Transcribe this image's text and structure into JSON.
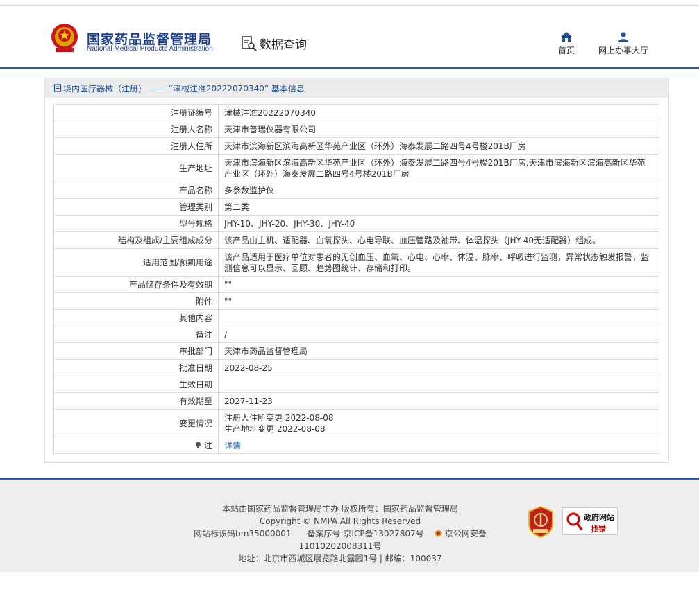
{
  "header": {
    "title_cn": "国家药品监督管理局",
    "title_en": "National Medical Products Administration",
    "data_query": "数据查询",
    "nav": [
      {
        "label": "首页",
        "icon": "home-icon"
      },
      {
        "label": "网上办事大厅",
        "icon": "user-icon"
      }
    ]
  },
  "panel": {
    "breadcrumb": "境内医疗器械（注册） —— “津械注准20222070340” 基本信息",
    "rows": [
      {
        "label": "注册证编号",
        "value": "津械注准20222070340"
      },
      {
        "label": "注册人名称",
        "value": "天津市普瑞仪器有限公司"
      },
      {
        "label": "注册人住所",
        "value": "天津市滨海新区滨海高新区华苑产业区（环外）海泰发展二路四号4号楼201B厂房"
      },
      {
        "label": "生产地址",
        "value": "天津市滨海新区滨海高新区华苑产业区（环外）海泰发展二路四号4号楼201B厂房,天津市滨海新区滨海高新区华苑产业区（环外）海泰发展二路四号4号楼201B厂房"
      },
      {
        "label": "产品名称",
        "value": "多参数监护仪"
      },
      {
        "label": "管理类别",
        "value": "第二类"
      },
      {
        "label": "型号规格",
        "value": "JHY-10、JHY-20、JHY-30、JHY-40"
      },
      {
        "label": "结构及组成/主要组成成分",
        "value": "该产品由主机、适配器、血氧探头、心电导联、血压管路及袖带、体温探头（JHY-40无适配器）组成。"
      },
      {
        "label": "适用范围/预期用途",
        "value": "该产品适用于医疗单位对患者的无创血压、血氧、心电、心率、体温、脉率、呼吸进行监测，异常状态触发报警，监测信息可以显示、回顾、趋势图统计、存储和打印。"
      },
      {
        "label": "产品储存条件及有效期",
        "value": "\"\""
      },
      {
        "label": "附件",
        "value": "\"\""
      },
      {
        "label": "其他内容",
        "value": ""
      },
      {
        "label": "备注",
        "value": "/"
      },
      {
        "label": "审批部门",
        "value": "天津市药品监督管理局"
      },
      {
        "label": "批准日期",
        "value": "2022-08-25"
      },
      {
        "label": "生效日期",
        "value": ""
      },
      {
        "label": "有效期至",
        "value": "2027-11-23"
      },
      {
        "label": "变更情况",
        "value": "注册人住所变更 2022-08-08",
        "value2": "生产地址变更 2022-08-08"
      }
    ],
    "note_label": "注",
    "note_link": "详情"
  },
  "footer": {
    "line1": "本站由国家药品监督管理局主办 版权所有：国家药品监督管理局",
    "line2": "Copyright © NMPA All Rights Reserved",
    "line3_id": "网站标识码bm35000001",
    "line3_icp": "备案序号:京ICP备13027807号",
    "line3_police": "京公网安备11010202008311号",
    "line4": "地址：北京市西城区展览路北露园1号 | 邮编：100037",
    "badge2_top": "政府网站",
    "badge2_bottom": "找错"
  }
}
